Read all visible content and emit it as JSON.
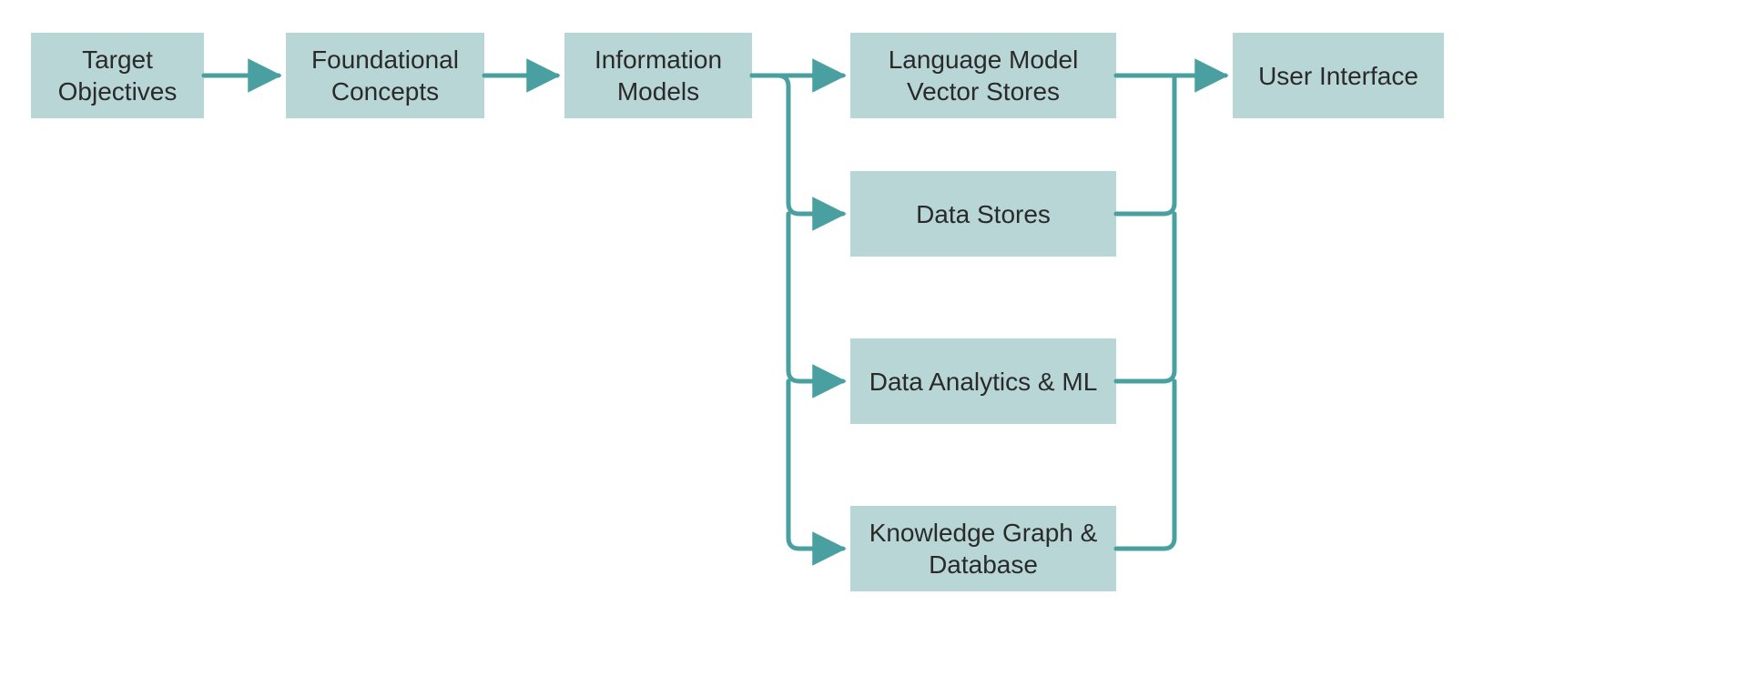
{
  "colors": {
    "box_fill": "#b8d6d6",
    "connector": "#4aa0a0",
    "text": "#2a2a2a"
  },
  "diagram": {
    "nodes": {
      "target_objectives": {
        "label": "Target Objectives"
      },
      "foundational_concepts": {
        "label": "Foundational Concepts"
      },
      "information_models": {
        "label": "Information Models"
      },
      "language_model_vectors": {
        "label": "Language Model Vector Stores"
      },
      "data_stores": {
        "label": "Data Stores"
      },
      "data_analytics_ml": {
        "label": "Data Analytics & ML"
      },
      "knowledge_graph_db": {
        "label": "Knowledge Graph & Database"
      },
      "user_interface": {
        "label": "User Interface"
      }
    },
    "edges": [
      {
        "from": "target_objectives",
        "to": "foundational_concepts"
      },
      {
        "from": "foundational_concepts",
        "to": "information_models"
      },
      {
        "from": "information_models",
        "to": "language_model_vectors"
      },
      {
        "from": "information_models",
        "to": "data_stores"
      },
      {
        "from": "information_models",
        "to": "data_analytics_ml"
      },
      {
        "from": "information_models",
        "to": "knowledge_graph_db"
      },
      {
        "from": "language_model_vectors",
        "to": "user_interface"
      },
      {
        "from": "data_stores",
        "to": "user_interface"
      },
      {
        "from": "data_analytics_ml",
        "to": "user_interface"
      },
      {
        "from": "knowledge_graph_db",
        "to": "user_interface"
      }
    ]
  }
}
